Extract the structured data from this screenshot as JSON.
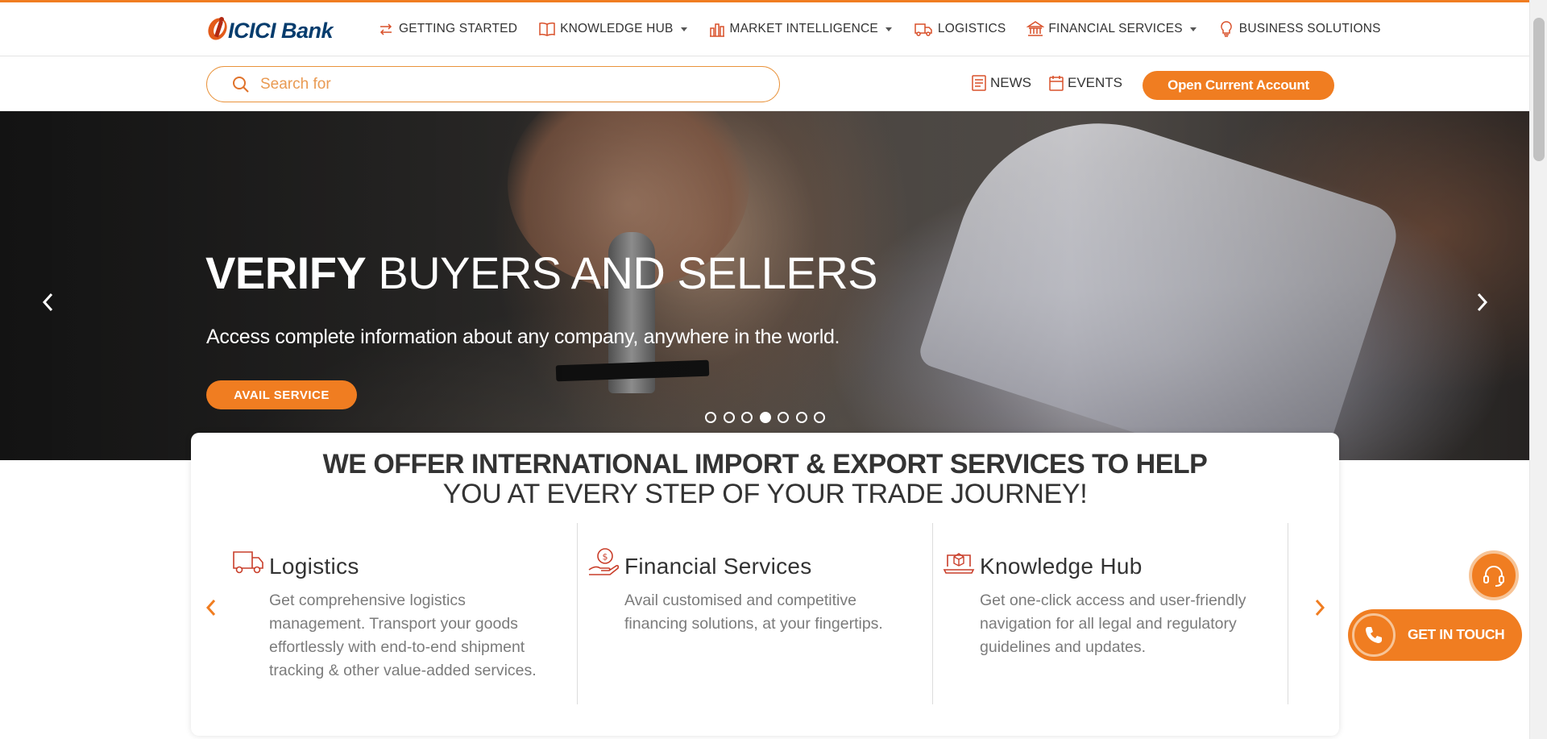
{
  "brand": {
    "name": "ICICI Bank",
    "accent_color": "#f07d21",
    "logo_color": "#053c6d"
  },
  "nav": {
    "items": [
      {
        "label": "GETTING STARTED",
        "icon": "arrows-exchange-icon",
        "dropdown": false
      },
      {
        "label": "KNOWLEDGE HUB",
        "icon": "book-icon",
        "dropdown": true
      },
      {
        "label": "MARKET INTELLIGENCE",
        "icon": "bar-chart-icon",
        "dropdown": true
      },
      {
        "label": "LOGISTICS",
        "icon": "truck-icon",
        "dropdown": false
      },
      {
        "label": "FINANCIAL SERVICES",
        "icon": "bank-icon",
        "dropdown": true
      },
      {
        "label": "BUSINESS SOLUTIONS",
        "icon": "lightbulb-icon",
        "dropdown": false
      }
    ]
  },
  "search": {
    "placeholder": "Search for",
    "value": ""
  },
  "quick_links": {
    "news": "NEWS",
    "events": "EVENTS"
  },
  "cta": {
    "open_account": "Open Current Account"
  },
  "hero": {
    "title_bold": "VERIFY",
    "title_rest": "BUYERS AND SELLERS",
    "subtitle": "Access complete information about any company, anywhere in the world.",
    "button": "AVAIL SERVICE",
    "slide_count": 7,
    "active_slide": 4
  },
  "offer": {
    "heading_bold": "WE OFFER INTERNATIONAL IMPORT & EXPORT SERVICES TO HELP",
    "heading_light": "YOU AT EVERY STEP OF YOUR TRADE JOURNEY!",
    "services": [
      {
        "title": "Logistics",
        "icon": "truck-icon",
        "description": "Get comprehensive logistics management. Transport your goods effortlessly with end-to-end shipment tracking & other value-added services."
      },
      {
        "title": "Financial Services",
        "icon": "money-hand-icon",
        "description": "Avail customised and competitive financing solutions, at your fingertips."
      },
      {
        "title": "Knowledge Hub",
        "icon": "laptop-box-icon",
        "description": "Get one-click access and user-friendly navigation for all legal and regulatory guidelines and updates."
      }
    ]
  },
  "floating": {
    "get_in_touch": "GET IN TOUCH"
  }
}
